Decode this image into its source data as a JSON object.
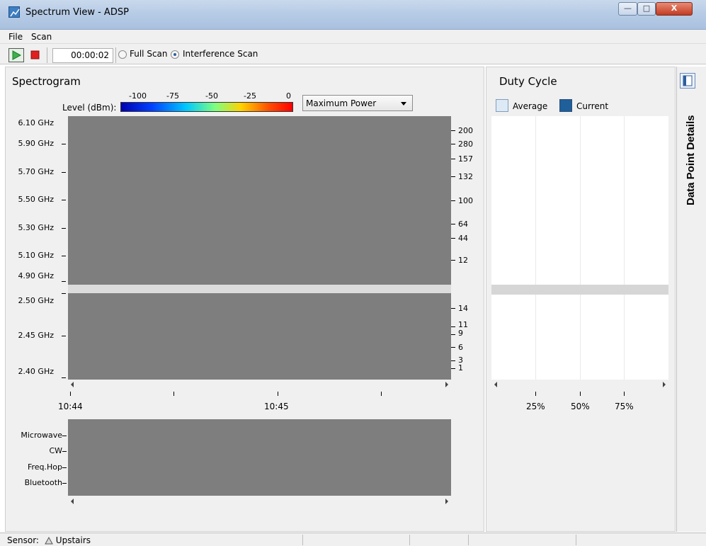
{
  "window": {
    "title": "Spectrum View - ADSP",
    "close_label": "X"
  },
  "menu": {
    "items": [
      "File",
      "Scan"
    ]
  },
  "toolbar": {
    "timer": "00:00:02",
    "scan_modes": [
      {
        "label": "Full Scan",
        "checked": false
      },
      {
        "label": "Interference Scan",
        "checked": true
      }
    ]
  },
  "spectrogram": {
    "title": "Spectrogram",
    "level_label": "Level (dBm):",
    "level_ticks": [
      "-100",
      "-75",
      "-50",
      "-25",
      "0"
    ],
    "display_select": "Maximum Power",
    "band_5ghz_labels": [
      "6.10 GHz",
      "5.90 GHz",
      "5.70 GHz",
      "5.50 GHz",
      "5.30 GHz",
      "5.10 GHz",
      "4.90 GHz"
    ],
    "band_5ghz_channels": [
      "200",
      "280",
      "157",
      "132",
      "100",
      "64",
      "44",
      "12"
    ],
    "band_24ghz_labels": [
      "2.50 GHz",
      "2.45 GHz",
      "2.40 GHz"
    ],
    "band_24ghz_channels": [
      "14",
      "11",
      "9",
      "6",
      "3",
      "1"
    ],
    "time_labels": [
      "10:44",
      "10:45"
    ],
    "interferer_labels": [
      "Microwave",
      "CW",
      "Freq.Hop",
      "Bluetooth"
    ]
  },
  "duty_cycle": {
    "title": "Duty Cycle",
    "legend": [
      {
        "label": "Average",
        "color": "#dde9f5"
      },
      {
        "label": "Current",
        "color": "#1f5f9a"
      }
    ],
    "axis_labels": [
      "25%",
      "50%",
      "75%"
    ]
  },
  "side_tab": {
    "label": "Data Point Details"
  },
  "status": {
    "sensor_label": "Sensor:",
    "sensor_name": "Upstairs"
  }
}
